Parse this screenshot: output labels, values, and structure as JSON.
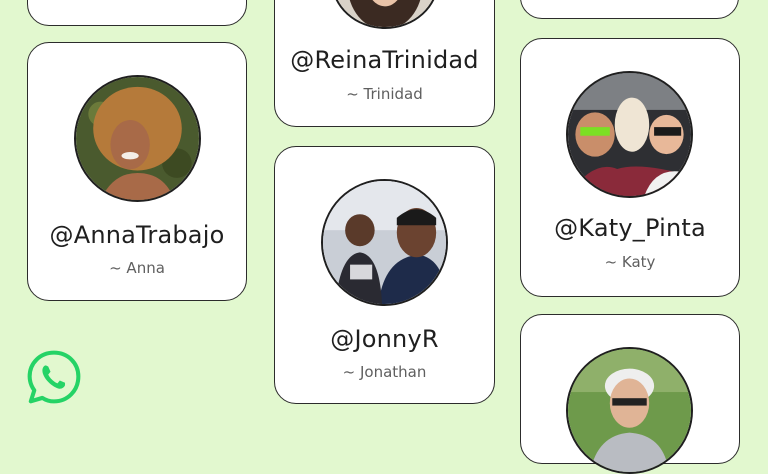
{
  "brand": {
    "logo_icon": "whatsapp-logo-icon",
    "accent": "#25D366",
    "background": "#E2F8CF"
  },
  "contacts": [
    {
      "handle": "@ReinaTrinidad",
      "name": "~ Trinidad"
    },
    {
      "handle": "@AnnaTrabajo",
      "name": "~ Anna"
    },
    {
      "handle": "@JonnyR",
      "name": "~ Jonathan"
    },
    {
      "handle": "@Katy_Pinta",
      "name": "~ Katy"
    }
  ]
}
